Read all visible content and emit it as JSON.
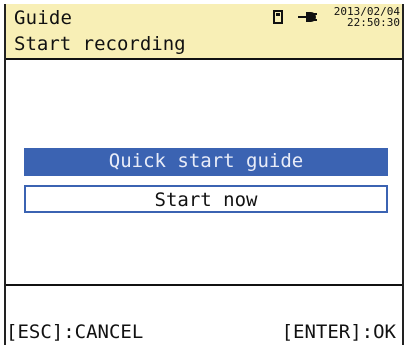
{
  "header": {
    "title": "Guide",
    "datetime_line1": "2013/02/04",
    "datetime_line2": "22:50:30",
    "icons": [
      "sd-card-icon",
      "ac-power-plug-icon"
    ]
  },
  "subheader": {
    "title": "Start recording"
  },
  "menu": {
    "items": [
      {
        "label": "Quick start guide",
        "selected": true
      },
      {
        "label": "Start now",
        "selected": false
      }
    ]
  },
  "footer": {
    "cancel_hint": "[ESC]:CANCEL",
    "ok_hint": "[ENTER]:OK"
  },
  "colors": {
    "status_bar": "#f8efb6",
    "selection": "#3b63b2"
  }
}
